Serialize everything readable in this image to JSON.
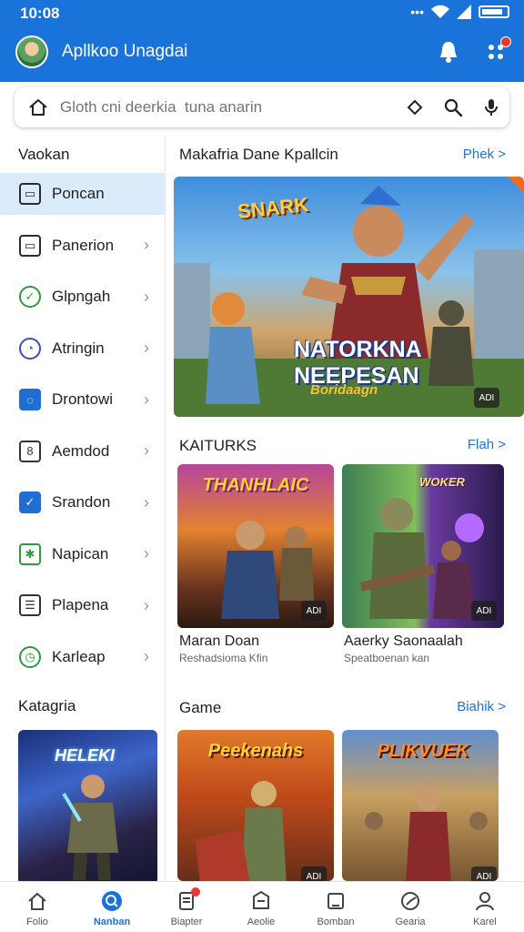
{
  "status": {
    "time": "10:08"
  },
  "app": {
    "title": "Apllkoo Unagdai"
  },
  "search": {
    "placeholder": "Gloth cni deerkia  tuna anarin"
  },
  "sidebar": {
    "title": "Vaokan",
    "items": [
      {
        "label": "Poncan",
        "icon": "gamepad-icon",
        "color": "#2c2c2c"
      },
      {
        "label": "Panerion",
        "icon": "controller-icon",
        "color": "#2c2c2c"
      },
      {
        "label": "Glpngah",
        "icon": "leaf-icon",
        "color": "#2e9a3d"
      },
      {
        "label": "Atringin",
        "icon": "compass-icon",
        "color": "#3b4fb5"
      },
      {
        "label": "Drontowi",
        "icon": "chat-icon",
        "color": "#1f6ed4"
      },
      {
        "label": "Aemdod",
        "icon": "number-icon",
        "color": "#333333"
      },
      {
        "label": "Srandon",
        "icon": "check-icon",
        "color": "#1f6ed4"
      },
      {
        "label": "Napican",
        "icon": "puzzle-icon",
        "color": "#2e9a3d"
      },
      {
        "label": "Plapena",
        "icon": "list-icon",
        "color": "#333333"
      },
      {
        "label": "Karleap",
        "icon": "clock-icon",
        "color": "#2e9a3d"
      }
    ],
    "category_title": "Katagria",
    "category_card_label": "HELEKI"
  },
  "sections": {
    "featured": {
      "title": "Makafria Dane Kpallcin",
      "link": "Phek >"
    },
    "second": {
      "title": "KAITURKS",
      "link": "Flah >"
    },
    "game": {
      "title": "Game",
      "link": "Biahik >"
    }
  },
  "banner": {
    "logo_top": "SNARK",
    "logo_main": "NATORKNA NEEPESAN",
    "logo_sub": "Boridaagn",
    "badge": "ADI"
  },
  "cards": [
    {
      "title": "Maran Doan",
      "subtitle": "Reshadsioma Kfin",
      "art_title": "THANHLAIC",
      "badge": "ADI"
    },
    {
      "title": "Aaerky Saonaalah",
      "subtitle": "Speatboenan kan",
      "art_title": "WOKER",
      "badge": "ADI"
    },
    {
      "title": "",
      "subtitle": "",
      "art_title": "Peekenahs",
      "badge": "ADI"
    },
    {
      "title": "",
      "subtitle": "",
      "art_title": "PLIKVUEK",
      "badge": "ADI"
    }
  ],
  "bottom_nav": [
    {
      "label": "Folio",
      "icon": "home-icon"
    },
    {
      "label": "Nanban",
      "icon": "search-icon"
    },
    {
      "label": "Biapter",
      "icon": "document-icon"
    },
    {
      "label": "Aeolie",
      "icon": "tray-icon"
    },
    {
      "label": "Bomban",
      "icon": "note-icon"
    },
    {
      "label": "Gearia",
      "icon": "chart-icon"
    },
    {
      "label": "Karel",
      "icon": "user-icon"
    }
  ],
  "colors": {
    "brand": "#1a73d9",
    "badge": "#e53935",
    "active_row": "#dcebf9"
  }
}
